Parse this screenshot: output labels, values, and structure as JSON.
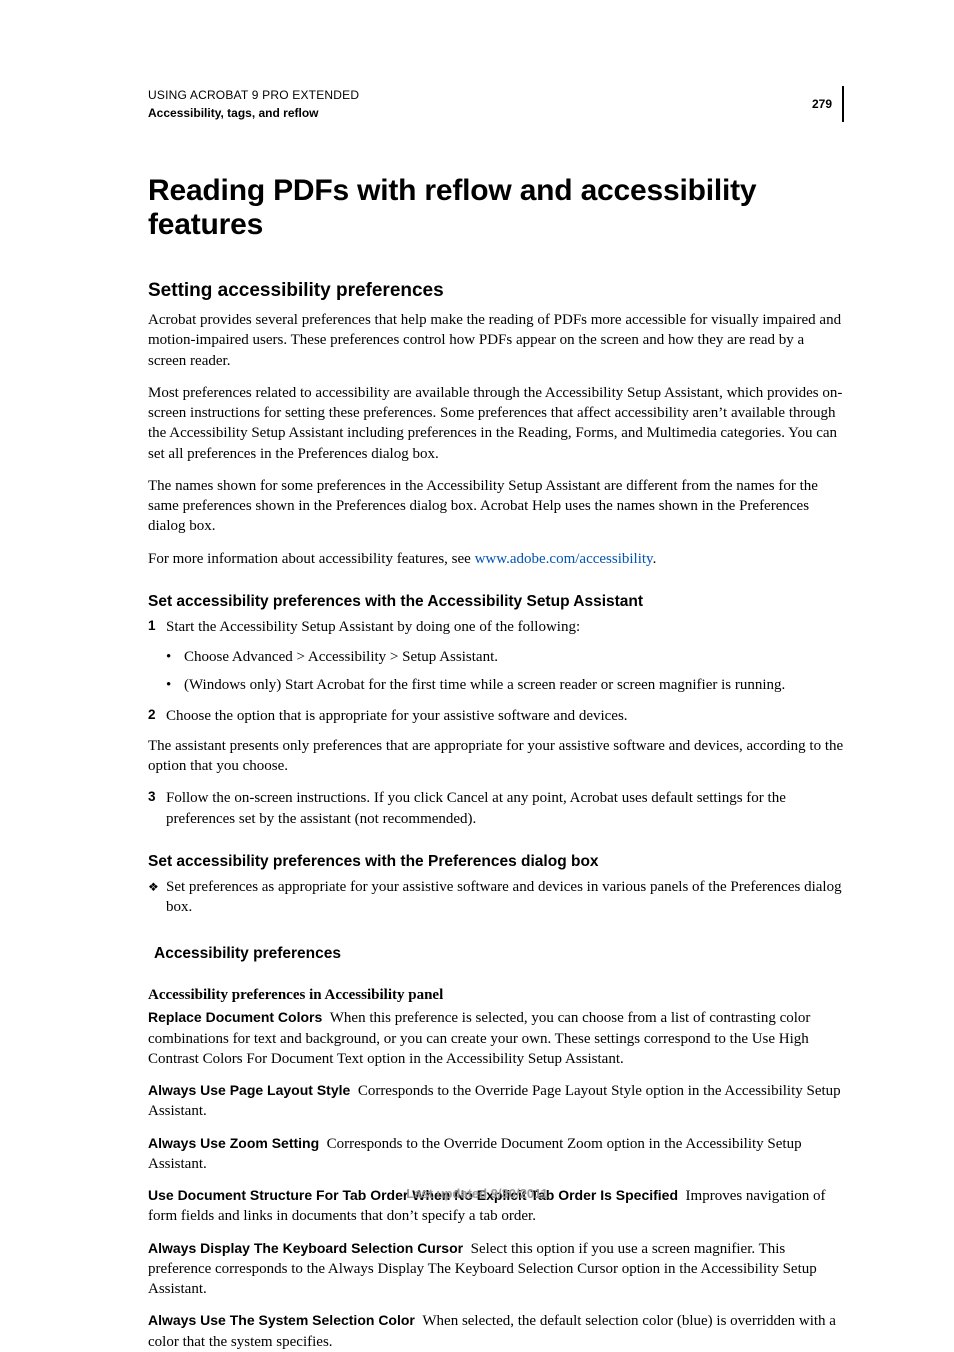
{
  "header": {
    "product": "USING ACROBAT 9 PRO EXTENDED",
    "section": "Accessibility, tags, and reflow",
    "page_number": "279"
  },
  "title": "Reading PDFs with reflow and accessibility features",
  "s1": {
    "heading": "Setting accessibility preferences",
    "p1": "Acrobat provides several preferences that help make the reading of PDFs more accessible for visually impaired and motion-impaired users. These preferences control how PDFs appear on the screen and how they are read by a screen reader.",
    "p2": "Most preferences related to accessibility are available through the Accessibility Setup Assistant, which provides on-screen instructions for setting these preferences. Some preferences that affect accessibility aren’t available through the Accessibility Setup Assistant including preferences in the Reading, Forms, and Multimedia categories. You can set all preferences in the Preferences dialog box.",
    "p3": "The names shown for some preferences in the Accessibility Setup Assistant are different from the names for the same preferences shown in the Preferences dialog box. Acrobat Help uses the names shown in the Preferences dialog box.",
    "p4_pre": "For more information about accessibility features, see ",
    "p4_link": "www.adobe.com/accessibility",
    "p4_post": "."
  },
  "s2": {
    "heading": "Set accessibility preferences with the Accessibility Setup Assistant",
    "step1": "Start the Accessibility Setup Assistant by doing one of the following:",
    "b1": "Choose Advanced > Accessibility > Setup Assistant.",
    "b2": "(Windows only) Start Acrobat for the first time while a screen reader or screen magnifier is running.",
    "step2": "Choose the option that is appropriate for your assistive software and devices.",
    "p1": "The assistant presents only preferences that are appropriate for your assistive software and devices, according to the option that you choose.",
    "step3": "Follow the on-screen instructions. If you click Cancel at any point, Acrobat uses default settings for the preferences set by the assistant (not recommended)."
  },
  "s3": {
    "heading": "Set accessibility preferences with the Preferences dialog box",
    "d1": "Set preferences as appropriate for your assistive software and devices in various panels of the Preferences dialog box."
  },
  "s4": {
    "heading": "Accessibility preferences",
    "panel_title": "Accessibility preferences in Accessibility panel",
    "defs": [
      {
        "term": "Replace Document Colors",
        "text": "When this preference is selected, you can choose from a list of contrasting color combinations for text and background, or you can create your own. These settings correspond to the Use High Contrast Colors For Document Text option in the Accessibility Setup Assistant."
      },
      {
        "term": "Always Use Page Layout Style",
        "text": "Corresponds to the Override Page Layout Style option in the Accessibility Setup Assistant."
      },
      {
        "term": "Always Use Zoom Setting",
        "text": "Corresponds to the Override Document Zoom option in the Accessibility Setup Assistant."
      },
      {
        "term": "Use Document Structure For Tab Order When No Explicit Tab Order Is Specified",
        "text": "Improves navigation of form fields and links in documents that don’t specify a tab order."
      },
      {
        "term": "Always Display The Keyboard Selection Cursor",
        "text": "Select this option if you use a screen magnifier. This preference corresponds to the Always Display The Keyboard Selection Cursor option in the Accessibility Setup Assistant."
      },
      {
        "term": "Always Use The System Selection Color",
        "text": "When selected, the default selection color (blue) is overridden with a color that the system specifies."
      }
    ]
  },
  "footer": "Last updated 9/30/2011",
  "markers": {
    "n1": "1",
    "n2": "2",
    "n3": "3",
    "bullet": "•",
    "diamond": "❖"
  }
}
